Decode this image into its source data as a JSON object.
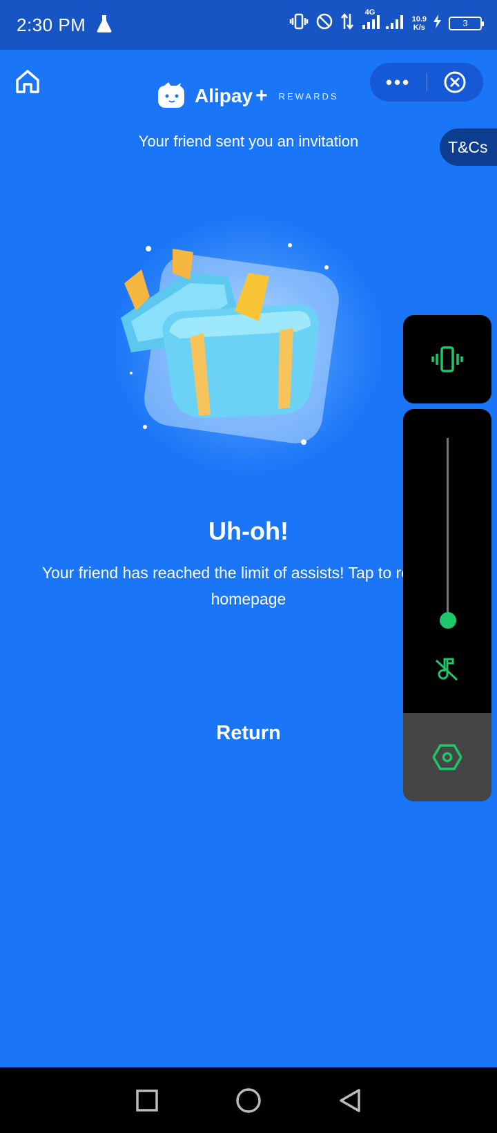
{
  "status_bar": {
    "time": "2:30 PM",
    "network": "4G",
    "speed_value": "10.9",
    "speed_unit": "K/s",
    "battery": "3"
  },
  "header": {
    "logo_name": "Alipay",
    "logo_plus": "+",
    "logo_tagline": "REWARDS",
    "more_label": "•••",
    "invitation_text": "Your friend sent you an invitation",
    "tcs_label": "T&Cs"
  },
  "main": {
    "headline": "Uh-oh!",
    "message": "Your friend has reached the limit of assists! Tap to return to homepage",
    "return_label": "Return"
  },
  "volume_panel": {
    "level": 0.0
  },
  "colors": {
    "background": "#1a76f7",
    "status_bar": "#1855c4",
    "accent_green": "#1ec86a",
    "panel_black": "#000000"
  },
  "icons": [
    "home-icon",
    "more-icon",
    "close-circle-icon",
    "vibrate-icon",
    "music-mute-icon",
    "settings-hex-icon",
    "recents-square-icon",
    "home-circle-icon",
    "back-triangle-icon",
    "flask-icon",
    "dnd-icon",
    "signal-icon",
    "battery-icon"
  ]
}
